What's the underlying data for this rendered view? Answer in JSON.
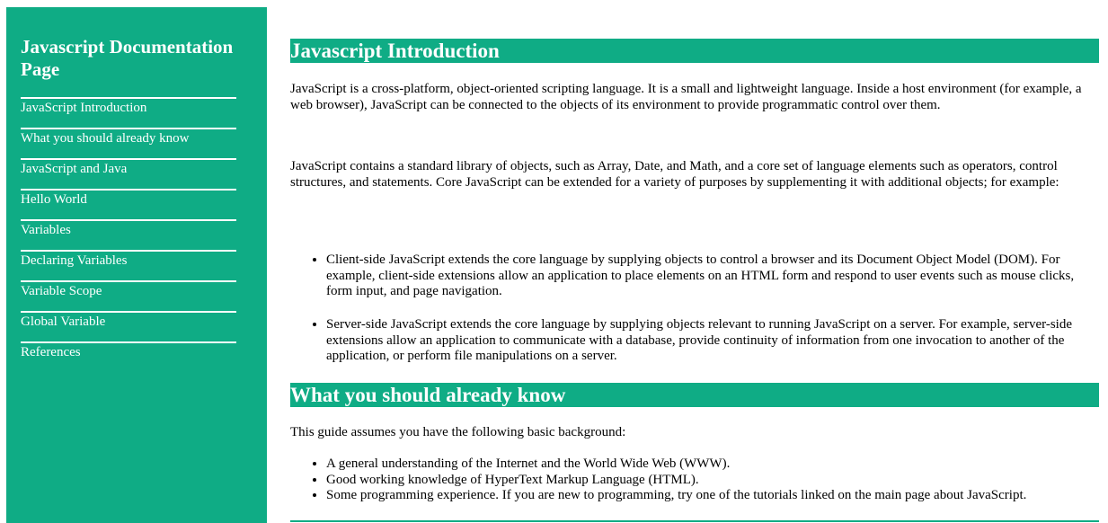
{
  "navbar": {
    "header": "Javascript Documentation Page",
    "links": [
      "JavaScript Introduction",
      "What you should already know",
      "JavaScript and Java",
      "Hello World",
      "Variables",
      "Declaring Variables",
      "Variable Scope",
      "Global Variable",
      "References"
    ]
  },
  "main": {
    "sections": [
      {
        "title": "Javascript Introduction",
        "paragraphs": [
          "JavaScript is a cross-platform, object-oriented scripting language. It is a small and lightweight language. Inside a host environment (for example, a web browser), JavaScript can be connected to the objects of its environment to provide programmatic control over them.",
          "JavaScript contains a standard library of objects, such as Array, Date, and Math, and a core set of language elements such as operators, control structures, and statements. Core JavaScript can be extended for a variety of purposes by supplementing it with additional objects; for example:"
        ],
        "bullets": [
          "Client-side JavaScript extends the core language by supplying objects to control a browser and its Document Object Model (DOM). For example, client-side extensions allow an application to place elements on an HTML form and respond to user events such as mouse clicks, form input, and page navigation.",
          "Server-side JavaScript extends the core language by supplying objects relevant to running JavaScript on a server. For example, server-side extensions allow an application to communicate with a database, provide continuity of information from one invocation to another of the application, or perform file manipulations on a server."
        ]
      },
      {
        "title": "What you should already know",
        "paragraphs": [
          "This guide assumes you have the following basic background:"
        ],
        "bullets": [
          "A general understanding of the Internet and the World Wide Web (WWW).",
          "Good working knowledge of HyperText Markup Language (HTML).",
          "Some programming experience. If you are new to programming, try one of the tutorials linked on the main page about JavaScript."
        ]
      }
    ]
  },
  "colors": {
    "accent": "#0fac85",
    "text": "#000000",
    "background": "#ffffff"
  }
}
